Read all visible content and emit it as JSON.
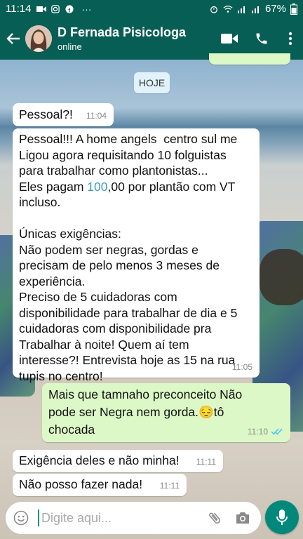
{
  "status_bar": {
    "time": "11:14",
    "dots": "···",
    "battery": "67%"
  },
  "header": {
    "contact_name": "D Fernada Pisicologa",
    "status": "online"
  },
  "date_chip": "HOJE",
  "messages": [
    {
      "text": "Pessoal?!",
      "time": "11:04"
    },
    {
      "text_part1": "Pessoal!!! A home angels  centro sul me\nLigou agora requisitando 10 folguistas\npara trabalhar como plantonistas...\nEles pagam ",
      "highlight": "100",
      "text_part2": ",00 por plantão com VT\nincluso.\n\nÚnicas exigências:\nNão podem ser negras, gordas e\nprecisam de pelo menos 3 meses de\nexperiência.\nPreciso de 5 cuidadoras com\ndisponibilidade para trabalhar de dia e 5\ncuidadoras com disponibilidade pra\nTrabalhar à noite! Quem aí tem\ninteresse?! Entrevista hoje as 15 na rua\ntupis no centro!",
      "time": "11:05"
    },
    {
      "text": "Mais que tamnaho preconceito Não\npode ser Negra nem gorda.😔tô\nchocada",
      "time": "11:10"
    },
    {
      "text": "Exigência deles e não minha!",
      "time": "11:11"
    },
    {
      "text": "Não posso fazer nada!",
      "time": "11:11"
    }
  ],
  "composer": {
    "placeholder": "Digite aqui..."
  },
  "colors": {
    "header": "#075e54",
    "outgoing_bubble": "#dcf8c6",
    "incoming_bubble": "#ffffff",
    "mic_button": "#00897b",
    "read_ticks": "#4fc3f7"
  },
  "icons": [
    "back-arrow-icon",
    "video-call-icon",
    "phone-icon",
    "more-vert-icon",
    "emoji-icon",
    "attach-icon",
    "camera-icon",
    "mic-icon"
  ]
}
